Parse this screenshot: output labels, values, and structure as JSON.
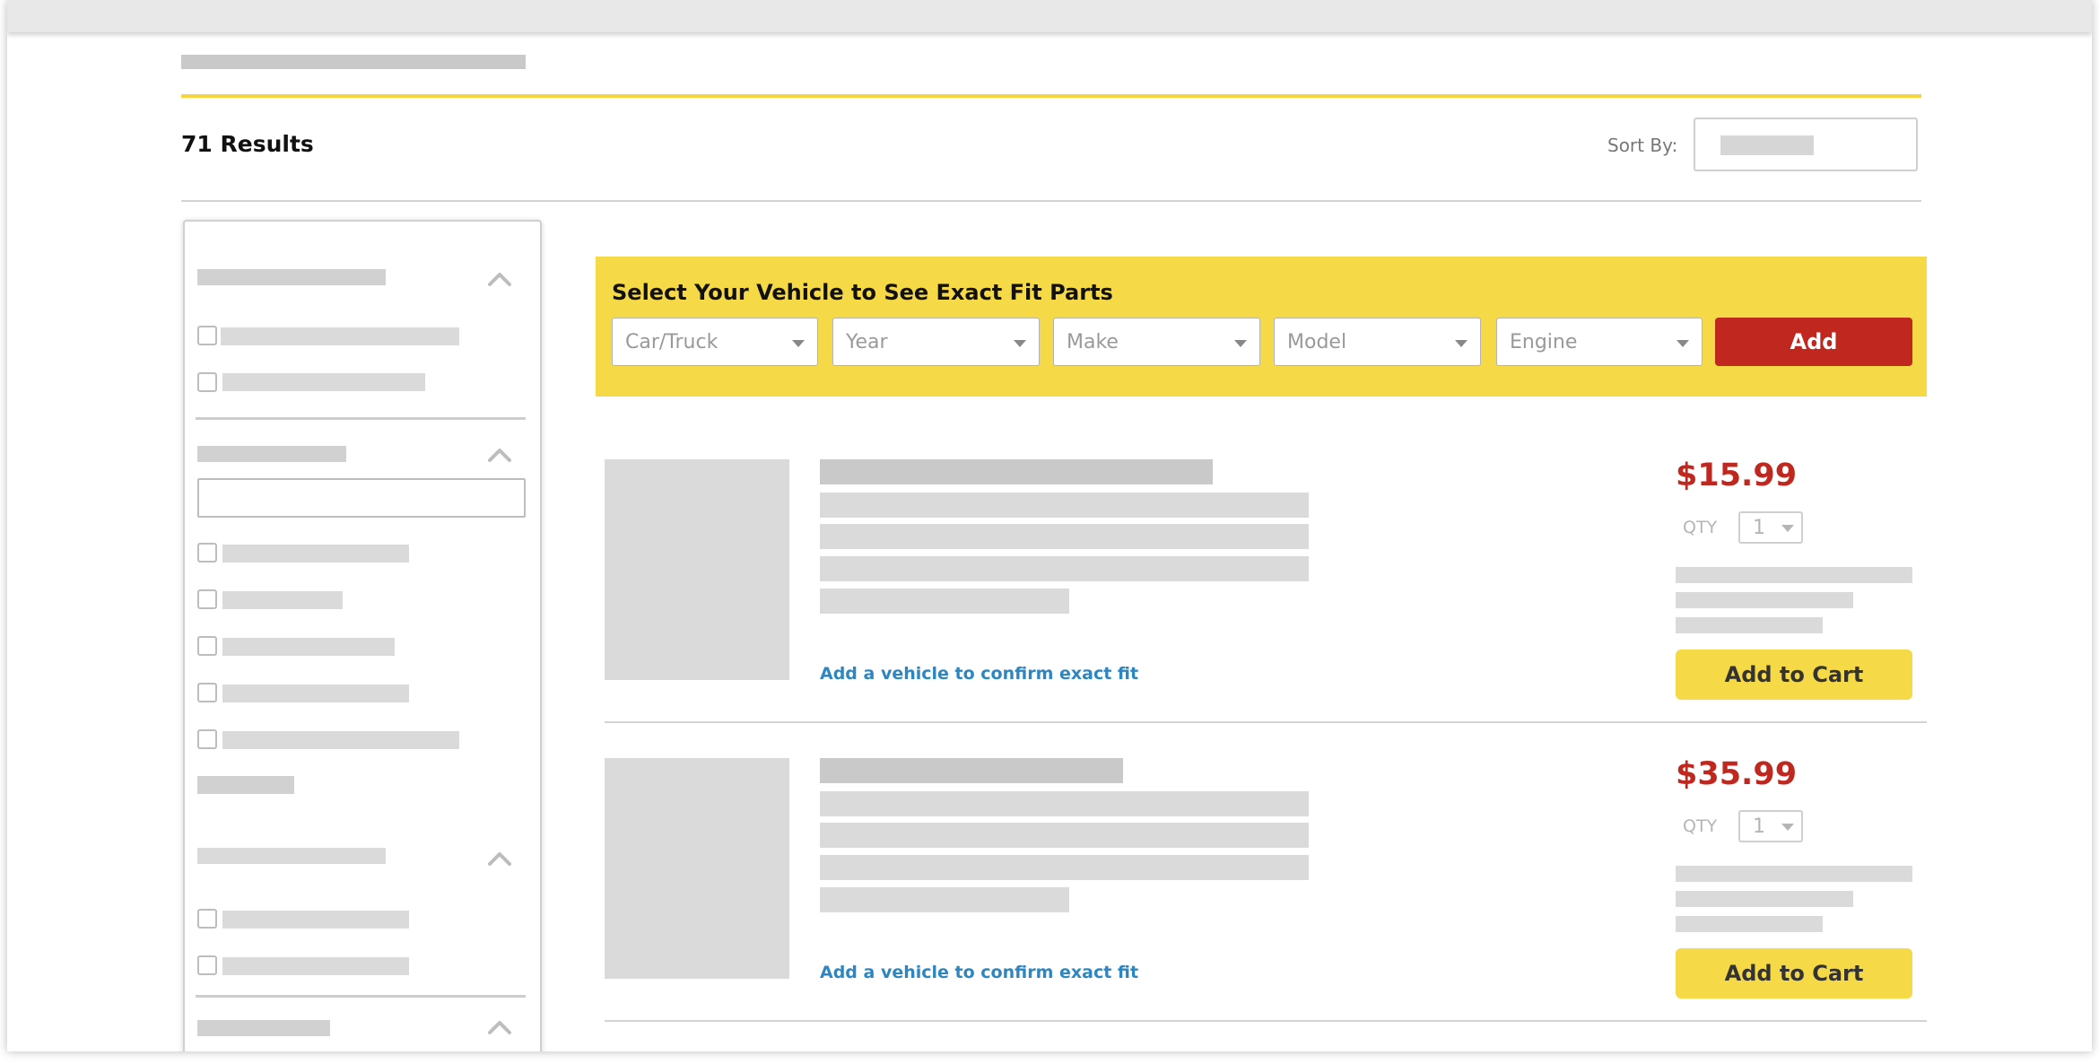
{
  "header": {
    "results_count": "71 Results",
    "sort_label": "Sort By:"
  },
  "vehicle_selector": {
    "title": "Select Your Vehicle to See Exact Fit Parts",
    "fields": [
      "Car/Truck",
      "Year",
      "Make",
      "Model",
      "Engine"
    ],
    "add_label": "Add"
  },
  "products": [
    {
      "price": "$15.99",
      "qty_label": "QTY",
      "qty_value": "1",
      "fit_link": "Add a vehicle to confirm exact fit",
      "cart_label": "Add to Cart"
    },
    {
      "price": "$35.99",
      "qty_label": "QTY",
      "qty_value": "1",
      "fit_link": "Add a vehicle to confirm exact fit",
      "cart_label": "Add to Cart"
    }
  ],
  "icons": {
    "filter_collapse": "chevron-up-icon",
    "select_caret": "caret-down-icon"
  },
  "colors": {
    "accent_yellow": "#f5d947",
    "price_red": "#c0281f",
    "link_blue": "#2e86c1"
  }
}
